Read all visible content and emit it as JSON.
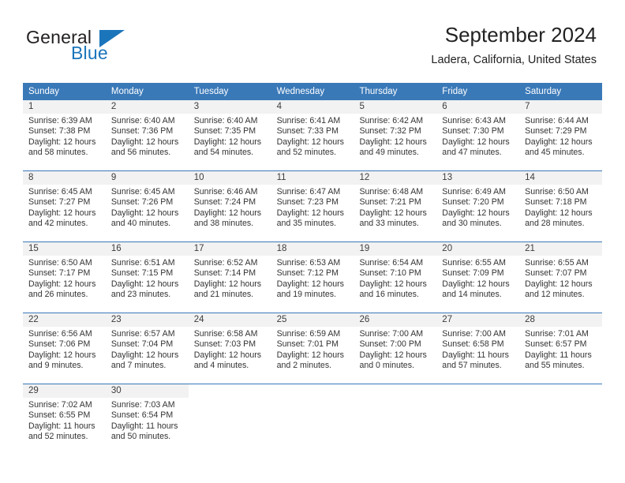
{
  "brand": {
    "name_part1": "General",
    "name_part2": "Blue",
    "accent_color": "#1b75bb"
  },
  "header": {
    "title": "September 2024",
    "location": "Ladera, California, United States"
  },
  "theme": {
    "header_bg": "#3a79b8",
    "day_number_bg": "#f2f2f2",
    "text_color": "#333333"
  },
  "weekdays": [
    "Sunday",
    "Monday",
    "Tuesday",
    "Wednesday",
    "Thursday",
    "Friday",
    "Saturday"
  ],
  "weeks": [
    [
      {
        "day": "1",
        "sunrise": "Sunrise: 6:39 AM",
        "sunset": "Sunset: 7:38 PM",
        "daylight_line1": "Daylight: 12 hours",
        "daylight_line2": "and 58 minutes."
      },
      {
        "day": "2",
        "sunrise": "Sunrise: 6:40 AM",
        "sunset": "Sunset: 7:36 PM",
        "daylight_line1": "Daylight: 12 hours",
        "daylight_line2": "and 56 minutes."
      },
      {
        "day": "3",
        "sunrise": "Sunrise: 6:40 AM",
        "sunset": "Sunset: 7:35 PM",
        "daylight_line1": "Daylight: 12 hours",
        "daylight_line2": "and 54 minutes."
      },
      {
        "day": "4",
        "sunrise": "Sunrise: 6:41 AM",
        "sunset": "Sunset: 7:33 PM",
        "daylight_line1": "Daylight: 12 hours",
        "daylight_line2": "and 52 minutes."
      },
      {
        "day": "5",
        "sunrise": "Sunrise: 6:42 AM",
        "sunset": "Sunset: 7:32 PM",
        "daylight_line1": "Daylight: 12 hours",
        "daylight_line2": "and 49 minutes."
      },
      {
        "day": "6",
        "sunrise": "Sunrise: 6:43 AM",
        "sunset": "Sunset: 7:30 PM",
        "daylight_line1": "Daylight: 12 hours",
        "daylight_line2": "and 47 minutes."
      },
      {
        "day": "7",
        "sunrise": "Sunrise: 6:44 AM",
        "sunset": "Sunset: 7:29 PM",
        "daylight_line1": "Daylight: 12 hours",
        "daylight_line2": "and 45 minutes."
      }
    ],
    [
      {
        "day": "8",
        "sunrise": "Sunrise: 6:45 AM",
        "sunset": "Sunset: 7:27 PM",
        "daylight_line1": "Daylight: 12 hours",
        "daylight_line2": "and 42 minutes."
      },
      {
        "day": "9",
        "sunrise": "Sunrise: 6:45 AM",
        "sunset": "Sunset: 7:26 PM",
        "daylight_line1": "Daylight: 12 hours",
        "daylight_line2": "and 40 minutes."
      },
      {
        "day": "10",
        "sunrise": "Sunrise: 6:46 AM",
        "sunset": "Sunset: 7:24 PM",
        "daylight_line1": "Daylight: 12 hours",
        "daylight_line2": "and 38 minutes."
      },
      {
        "day": "11",
        "sunrise": "Sunrise: 6:47 AM",
        "sunset": "Sunset: 7:23 PM",
        "daylight_line1": "Daylight: 12 hours",
        "daylight_line2": "and 35 minutes."
      },
      {
        "day": "12",
        "sunrise": "Sunrise: 6:48 AM",
        "sunset": "Sunset: 7:21 PM",
        "daylight_line1": "Daylight: 12 hours",
        "daylight_line2": "and 33 minutes."
      },
      {
        "day": "13",
        "sunrise": "Sunrise: 6:49 AM",
        "sunset": "Sunset: 7:20 PM",
        "daylight_line1": "Daylight: 12 hours",
        "daylight_line2": "and 30 minutes."
      },
      {
        "day": "14",
        "sunrise": "Sunrise: 6:50 AM",
        "sunset": "Sunset: 7:18 PM",
        "daylight_line1": "Daylight: 12 hours",
        "daylight_line2": "and 28 minutes."
      }
    ],
    [
      {
        "day": "15",
        "sunrise": "Sunrise: 6:50 AM",
        "sunset": "Sunset: 7:17 PM",
        "daylight_line1": "Daylight: 12 hours",
        "daylight_line2": "and 26 minutes."
      },
      {
        "day": "16",
        "sunrise": "Sunrise: 6:51 AM",
        "sunset": "Sunset: 7:15 PM",
        "daylight_line1": "Daylight: 12 hours",
        "daylight_line2": "and 23 minutes."
      },
      {
        "day": "17",
        "sunrise": "Sunrise: 6:52 AM",
        "sunset": "Sunset: 7:14 PM",
        "daylight_line1": "Daylight: 12 hours",
        "daylight_line2": "and 21 minutes."
      },
      {
        "day": "18",
        "sunrise": "Sunrise: 6:53 AM",
        "sunset": "Sunset: 7:12 PM",
        "daylight_line1": "Daylight: 12 hours",
        "daylight_line2": "and 19 minutes."
      },
      {
        "day": "19",
        "sunrise": "Sunrise: 6:54 AM",
        "sunset": "Sunset: 7:10 PM",
        "daylight_line1": "Daylight: 12 hours",
        "daylight_line2": "and 16 minutes."
      },
      {
        "day": "20",
        "sunrise": "Sunrise: 6:55 AM",
        "sunset": "Sunset: 7:09 PM",
        "daylight_line1": "Daylight: 12 hours",
        "daylight_line2": "and 14 minutes."
      },
      {
        "day": "21",
        "sunrise": "Sunrise: 6:55 AM",
        "sunset": "Sunset: 7:07 PM",
        "daylight_line1": "Daylight: 12 hours",
        "daylight_line2": "and 12 minutes."
      }
    ],
    [
      {
        "day": "22",
        "sunrise": "Sunrise: 6:56 AM",
        "sunset": "Sunset: 7:06 PM",
        "daylight_line1": "Daylight: 12 hours",
        "daylight_line2": "and 9 minutes."
      },
      {
        "day": "23",
        "sunrise": "Sunrise: 6:57 AM",
        "sunset": "Sunset: 7:04 PM",
        "daylight_line1": "Daylight: 12 hours",
        "daylight_line2": "and 7 minutes."
      },
      {
        "day": "24",
        "sunrise": "Sunrise: 6:58 AM",
        "sunset": "Sunset: 7:03 PM",
        "daylight_line1": "Daylight: 12 hours",
        "daylight_line2": "and 4 minutes."
      },
      {
        "day": "25",
        "sunrise": "Sunrise: 6:59 AM",
        "sunset": "Sunset: 7:01 PM",
        "daylight_line1": "Daylight: 12 hours",
        "daylight_line2": "and 2 minutes."
      },
      {
        "day": "26",
        "sunrise": "Sunrise: 7:00 AM",
        "sunset": "Sunset: 7:00 PM",
        "daylight_line1": "Daylight: 12 hours",
        "daylight_line2": "and 0 minutes."
      },
      {
        "day": "27",
        "sunrise": "Sunrise: 7:00 AM",
        "sunset": "Sunset: 6:58 PM",
        "daylight_line1": "Daylight: 11 hours",
        "daylight_line2": "and 57 minutes."
      },
      {
        "day": "28",
        "sunrise": "Sunrise: 7:01 AM",
        "sunset": "Sunset: 6:57 PM",
        "daylight_line1": "Daylight: 11 hours",
        "daylight_line2": "and 55 minutes."
      }
    ],
    [
      {
        "day": "29",
        "sunrise": "Sunrise: 7:02 AM",
        "sunset": "Sunset: 6:55 PM",
        "daylight_line1": "Daylight: 11 hours",
        "daylight_line2": "and 52 minutes."
      },
      {
        "day": "30",
        "sunrise": "Sunrise: 7:03 AM",
        "sunset": "Sunset: 6:54 PM",
        "daylight_line1": "Daylight: 11 hours",
        "daylight_line2": "and 50 minutes."
      },
      {
        "day": "",
        "sunrise": "",
        "sunset": "",
        "daylight_line1": "",
        "daylight_line2": ""
      },
      {
        "day": "",
        "sunrise": "",
        "sunset": "",
        "daylight_line1": "",
        "daylight_line2": ""
      },
      {
        "day": "",
        "sunrise": "",
        "sunset": "",
        "daylight_line1": "",
        "daylight_line2": ""
      },
      {
        "day": "",
        "sunrise": "",
        "sunset": "",
        "daylight_line1": "",
        "daylight_line2": ""
      },
      {
        "day": "",
        "sunrise": "",
        "sunset": "",
        "daylight_line1": "",
        "daylight_line2": ""
      }
    ]
  ]
}
